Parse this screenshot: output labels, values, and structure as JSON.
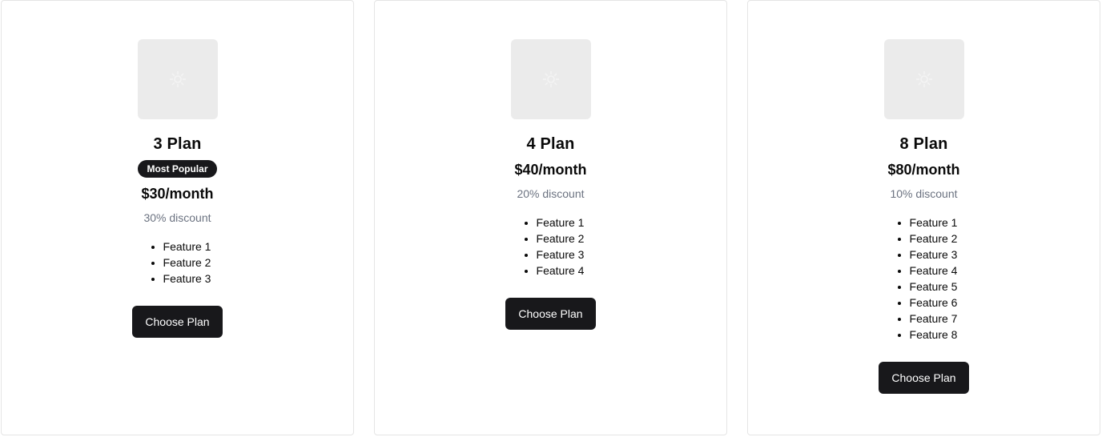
{
  "plans": [
    {
      "name": "3 Plan",
      "badge": "Most Popular",
      "price": "$30/month",
      "discount": "30% discount",
      "features": [
        "Feature 1",
        "Feature 2",
        "Feature 3"
      ],
      "cta": "Choose Plan",
      "image_icon": "image-placeholder-icon"
    },
    {
      "name": "4 Plan",
      "price": "$40/month",
      "discount": "20% discount",
      "features": [
        "Feature 1",
        "Feature 2",
        "Feature 3",
        "Feature 4"
      ],
      "cta": "Choose Plan",
      "image_icon": "image-placeholder-icon"
    },
    {
      "name": "8 Plan",
      "price": "$80/month",
      "discount": "10% discount",
      "features": [
        "Feature 1",
        "Feature 2",
        "Feature 3",
        "Feature 4",
        "Feature 5",
        "Feature 6",
        "Feature 7",
        "Feature 8"
      ],
      "cta": "Choose Plan",
      "image_icon": "image-placeholder-icon"
    }
  ],
  "colors": {
    "card_border": "#e5e5e5",
    "thumb_bg": "#ebebeb",
    "button_bg": "#18181b",
    "badge_bg": "#18181b",
    "muted_text": "#6b7280"
  }
}
